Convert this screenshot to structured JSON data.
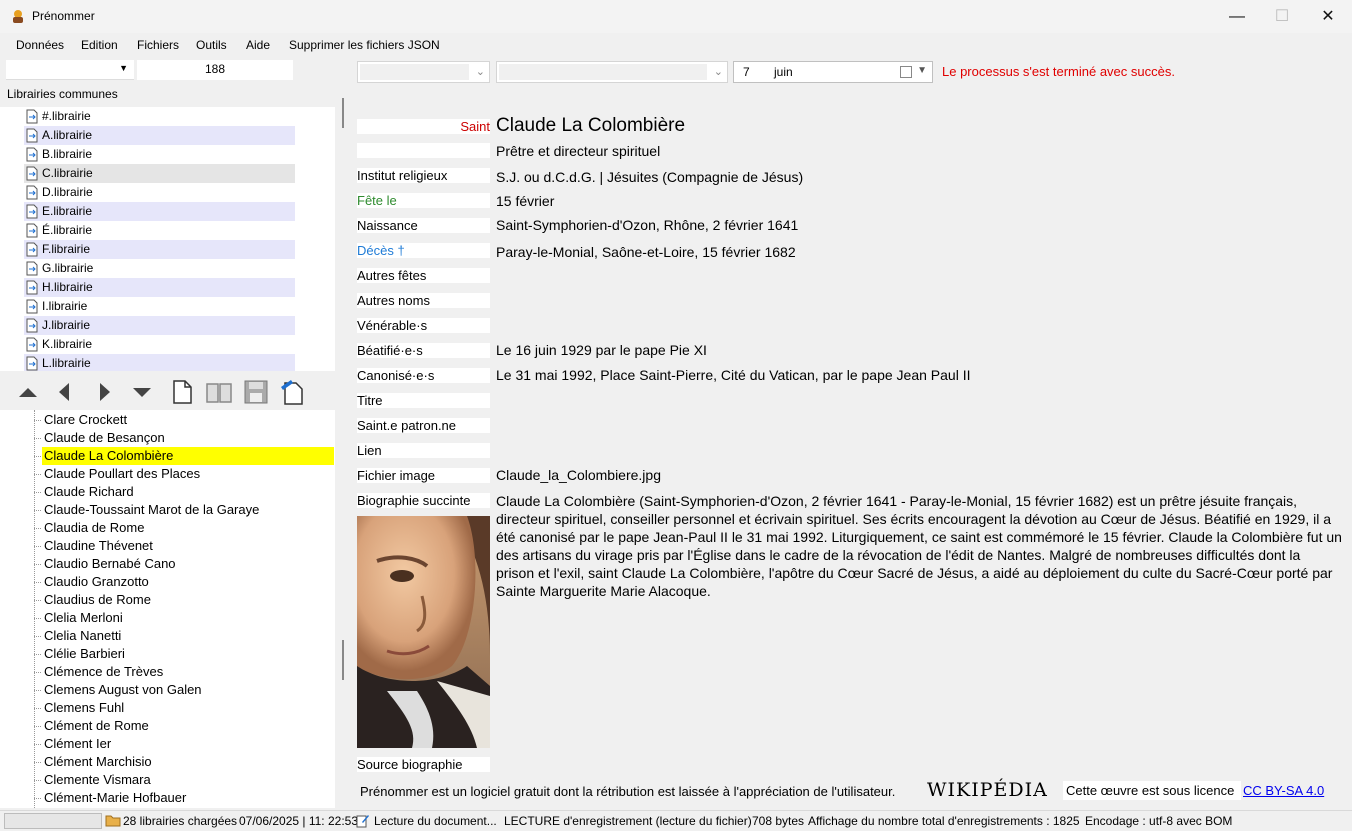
{
  "window": {
    "title": "Prénommer",
    "minimize": "—",
    "maximize": "☐",
    "close": "✕"
  },
  "menu": [
    "Données",
    "Edition",
    "Fichiers",
    "Outils",
    "Aide",
    "Supprimer les fichiers JSON"
  ],
  "left": {
    "count": "188",
    "libraries_header": "Librairies communes",
    "libraries": [
      "#.librairie",
      "A.librairie",
      "B.librairie",
      "C.librairie",
      "D.librairie",
      "E.librairie",
      "É.librairie",
      "F.librairie",
      "G.librairie",
      "H.librairie",
      "I.librairie",
      "J.librairie",
      "K.librairie",
      "L.librairie"
    ],
    "names": [
      "Clare Crockett",
      "Claude de Besançon",
      "Claude La Colombière",
      "Claude Poullart des Places",
      "Claude Richard",
      "Claude-Toussaint Marot de la Garaye",
      "Claudia de Rome",
      "Claudine Thévenet",
      "Claudio Bernabé Cano",
      "Claudio Granzotto",
      "Claudius de Rome",
      "Clelia Merloni",
      "Clelia Nanetti",
      "Clélie Barbieri",
      "Clémence de Trèves",
      "Clemens August von Galen",
      "Clemens Fuhl",
      "Clément de Rome",
      "Clément Ier",
      "Clément Marchisio",
      "Clemente Vismara",
      "Clément-Marie Hofbauer"
    ],
    "selected_name_index": 2
  },
  "top": {
    "date_day": "7",
    "date_month": "juin",
    "status_message": "Le processus s'est terminé avec succès."
  },
  "detail": {
    "saint_label": "Saint",
    "name": "Claude La Colombière",
    "subtitle": "Prêtre et directeur spirituel",
    "labels": {
      "institut": "Institut religieux",
      "fete": "Fête le",
      "naissance": "Naissance",
      "deces": "Décès †",
      "autres_fetes": "Autres fêtes",
      "autres_noms": "Autres noms",
      "venerable": "Vénérable·s",
      "beatifie": "Béatifié·e·s",
      "canonise": "Canonisé·e·s",
      "titre": "Titre",
      "patron": "Saint.e patron.ne",
      "lien": "Lien",
      "fichier_image": "Fichier image",
      "biographie": "Biographie succinte",
      "source": "Source biographie"
    },
    "values": {
      "institut": "S.J. ou d.C.d.G. | Jésuites (Compagnie de Jésus)",
      "fete": "15 février",
      "naissance": "Saint-Symphorien-d'Ozon, Rhône, 2 février 1641",
      "deces": "Paray-le-Monial, Saône-et-Loire, 15 février 1682",
      "beatifie": "Le 16 juin 1929 par le pape Pie XI",
      "canonise": "Le 31 mai 1992, Place Saint-Pierre, Cité du Vatican, par le pape Jean Paul II",
      "fichier_image": "Claude_la_Colombiere.jpg"
    },
    "biography": "Claude La Colombière (Saint-Symphorien-d'Ozon, 2 février 1641 - Paray-le-Monial, 15 février 1682) est un prêtre jésuite français, directeur spirituel, conseiller personnel et écrivain spirituel. Ses écrits encouragent la dévotion au Cœur de Jésus. Béatifié en 1929, il a été canonisé par le pape Jean-Paul II le 31 mai 1992. Liturgiquement, ce saint est commémoré le 15 février. Claude la Colombière fut un des artisans du virage pris par l'Église dans le cadre de la révocation de l'édit de Nantes. Malgré de nombreuses difficultés dont la prison et l'exil, saint Claude La Colombière, l'apôtre du Cœur Sacré de Jésus, a aidé au déploiement du culte du Sacré-Cœur porté par Sainte Marguerite Marie Alacoque."
  },
  "footer": {
    "free_note": "Prénommer est un logiciel gratuit dont la rétribution est laissée à l'appréciation de l'utilisateur.",
    "wikipedia": "WIKIPÉDIA",
    "license_text": "Cette œuvre est sous licence",
    "license_link": "CC BY-SA 4.0"
  },
  "statusbar": {
    "libraries_loaded": "28 librairies chargées",
    "datetime": "07/06/2025 | 11: 22:53",
    "reading": "Lecture du document...",
    "record_read": "LECTURE d'enregistrement (lecture du fichier)",
    "bytes": "708 bytes",
    "display_total": "Affichage du nombre total d'enregistrements : 1825",
    "encoding": "Encodage : utf-8 avec BOM"
  },
  "colors": {
    "accent_red": "#cc0000",
    "fete_green": "#2e8b2e",
    "deces_blue": "#1e7bd6",
    "selected_yellow": "#ffff00"
  }
}
